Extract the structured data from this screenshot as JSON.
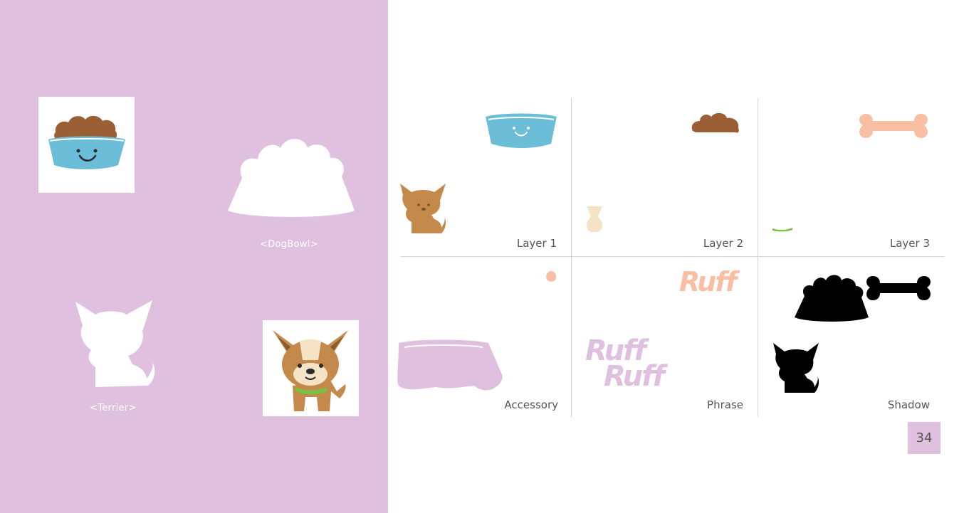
{
  "colors": {
    "pink": "#dfc1df",
    "blue": "#6bbdd8",
    "brown": "#9b5f35",
    "peach": "#f9bfa3",
    "tan": "#c48a4c",
    "black": "#000000",
    "green": "#7ac043"
  },
  "left": {
    "dogbowl_label": "<DogBowl>",
    "terrier_label": "<Terrier>"
  },
  "layers": {
    "layer1": "Layer 1",
    "layer2": "Layer 2",
    "layer3": "Layer 3",
    "accessory": "Accessory",
    "phrase": "Phrase",
    "shadow": "Shadow"
  },
  "phrases": {
    "ruff_single": "Ruff",
    "ruff_line1": "Ruff",
    "ruff_line2": "Ruff"
  },
  "page_number": "34"
}
